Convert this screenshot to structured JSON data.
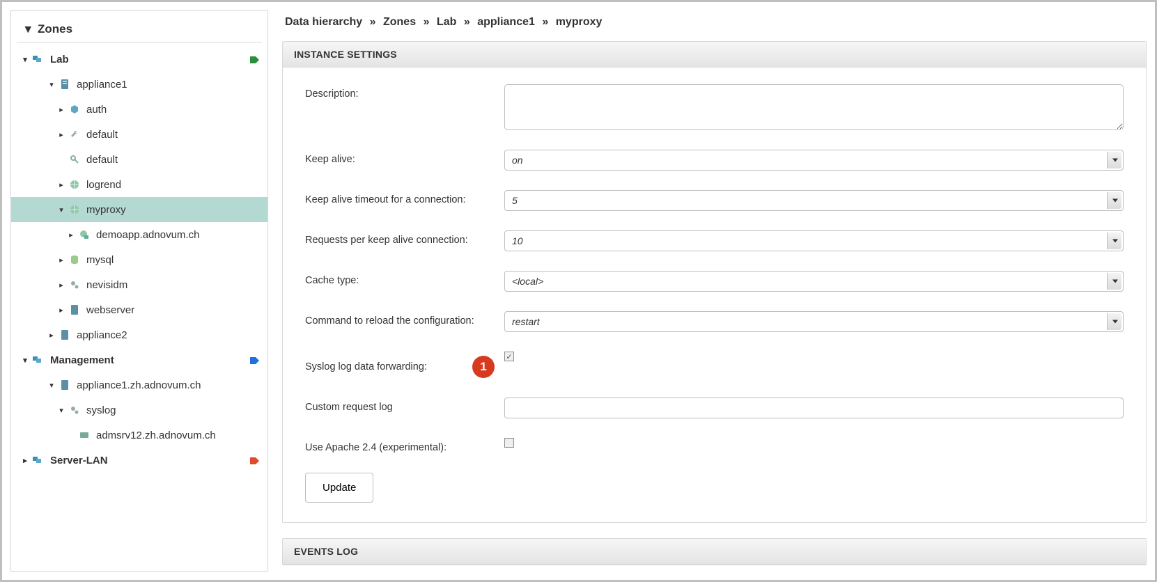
{
  "sidebar": {
    "title": "Zones",
    "groups": [
      {
        "label": "Lab",
        "tag_color": "#2a8f3a",
        "children": [
          {
            "label": "appliance1",
            "icon": "server",
            "children": [
              {
                "label": "auth",
                "icon": "cube-blue"
              },
              {
                "label": "default",
                "icon": "wrench"
              },
              {
                "label": "default",
                "icon": "key"
              },
              {
                "label": "logrend",
                "icon": "globe"
              },
              {
                "label": "myproxy",
                "icon": "globe",
                "selected": true,
                "children": [
                  {
                    "label": "demoapp.adnovum.ch",
                    "icon": "globe-stack"
                  }
                ]
              },
              {
                "label": "mysql",
                "icon": "db"
              },
              {
                "label": "nevisidm",
                "icon": "gears"
              },
              {
                "label": "webserver",
                "icon": "server"
              }
            ]
          },
          {
            "label": "appliance2",
            "icon": "server"
          }
        ]
      },
      {
        "label": "Management",
        "tag_color": "#1e6fe0",
        "children": [
          {
            "label": "appliance1.zh.adnovum.ch",
            "icon": "server",
            "children": [
              {
                "label": "syslog",
                "icon": "gears",
                "children": [
                  {
                    "label": "admsrv12.zh.adnovum.ch",
                    "icon": "server-small"
                  }
                ]
              }
            ]
          }
        ]
      },
      {
        "label": "Server-LAN",
        "tag_color": "#e04a2a"
      }
    ]
  },
  "breadcrumb": [
    "Data hierarchy",
    "Zones",
    "Lab",
    "appliance1",
    "myproxy"
  ],
  "panel_instance_title": "INSTANCE SETTINGS",
  "panel_events_title": "EVENTS LOG",
  "form": {
    "description": {
      "label": "Description:",
      "value": ""
    },
    "keepalive": {
      "label": "Keep alive:",
      "value": "on"
    },
    "keepalive_timeout": {
      "label": "Keep alive timeout for a connection:",
      "value": "5"
    },
    "requests_per_keepalive": {
      "label": "Requests per keep alive connection:",
      "value": "10"
    },
    "cache_type": {
      "label": "Cache type:",
      "value": "<local>"
    },
    "reload_cmd": {
      "label": "Command to reload the configuration:",
      "value": "restart"
    },
    "syslog_fwd": {
      "label": "Syslog log data forwarding:",
      "checked": true,
      "badge": "1"
    },
    "custom_req_log": {
      "label": "Custom request log",
      "value": ""
    },
    "apache24": {
      "label": "Use Apache 2.4 (experimental):",
      "checked": false
    },
    "update_label": "Update"
  }
}
